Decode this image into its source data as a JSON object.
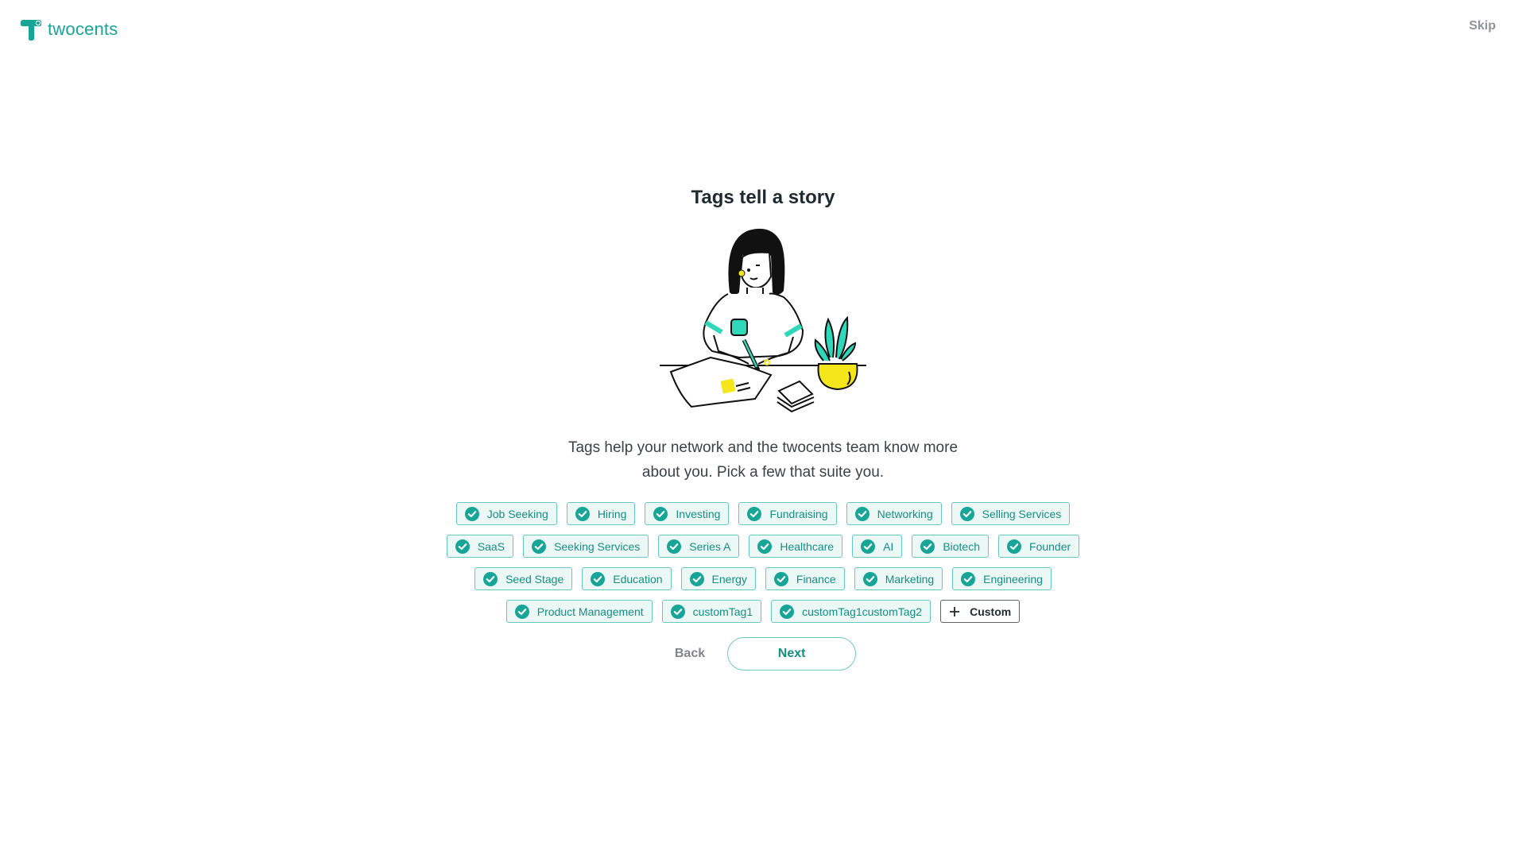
{
  "header": {
    "brand": "twocents",
    "skip_label": "Skip"
  },
  "main": {
    "title": "Tags tell a story",
    "illustration_icon": "woman-writing-illustration",
    "subtitle": "Tags help your network and the twocents team know more about you. Pick a few that suite you.",
    "tags": [
      {
        "label": "Job Seeking",
        "selected": true
      },
      {
        "label": "Hiring",
        "selected": true
      },
      {
        "label": "Investing",
        "selected": true
      },
      {
        "label": "Fundraising",
        "selected": true
      },
      {
        "label": "Networking",
        "selected": true
      },
      {
        "label": "Selling Services",
        "selected": true
      },
      {
        "label": "SaaS",
        "selected": true
      },
      {
        "label": "Seeking Services",
        "selected": true
      },
      {
        "label": "Series A",
        "selected": true
      },
      {
        "label": "Healthcare",
        "selected": true
      },
      {
        "label": "AI",
        "selected": true
      },
      {
        "label": "Biotech",
        "selected": true
      },
      {
        "label": "Founder",
        "selected": true
      },
      {
        "label": "Seed Stage",
        "selected": true
      },
      {
        "label": "Education",
        "selected": true
      },
      {
        "label": "Energy",
        "selected": true
      },
      {
        "label": "Finance",
        "selected": true
      },
      {
        "label": "Marketing",
        "selected": true
      },
      {
        "label": "Engineering",
        "selected": true
      },
      {
        "label": "Product Management",
        "selected": true
      },
      {
        "label": "customTag1",
        "selected": true
      },
      {
        "label": "customTag1customTag2",
        "selected": true
      }
    ],
    "custom_tag_label": "Custom",
    "back_label": "Back",
    "next_label": "Next"
  },
  "colors": {
    "brand_teal": "#17a597",
    "tag_border": "#67c9be",
    "tag_background": "#ecf8f6",
    "accent_yellow": "#f5e51b",
    "accent_green": "#2ed8b8"
  }
}
